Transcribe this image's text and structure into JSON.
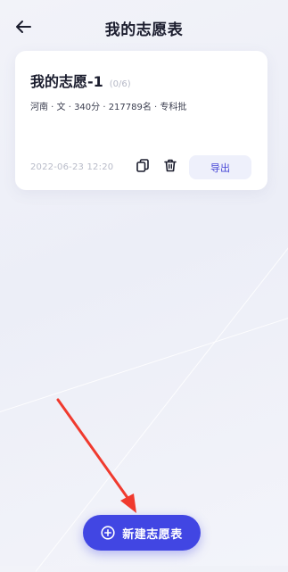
{
  "header": {
    "title": "我的志愿表",
    "back_icon": "arrow-left-icon"
  },
  "plan_card": {
    "title": "我的志愿-1",
    "count": "(0/6)",
    "info": "河南 · 文 · 340分 · 217789名 · 专科批",
    "date": "2022-06-23 12:20",
    "copy_icon": "copy-icon",
    "delete_icon": "trash-icon",
    "export_label": "导出"
  },
  "fab": {
    "label": "新建志愿表",
    "icon": "plus-circle-icon"
  },
  "colors": {
    "accent": "#4146e3",
    "annotation_arrow": "#f03a2e",
    "export_bg": "#eef0fb"
  }
}
